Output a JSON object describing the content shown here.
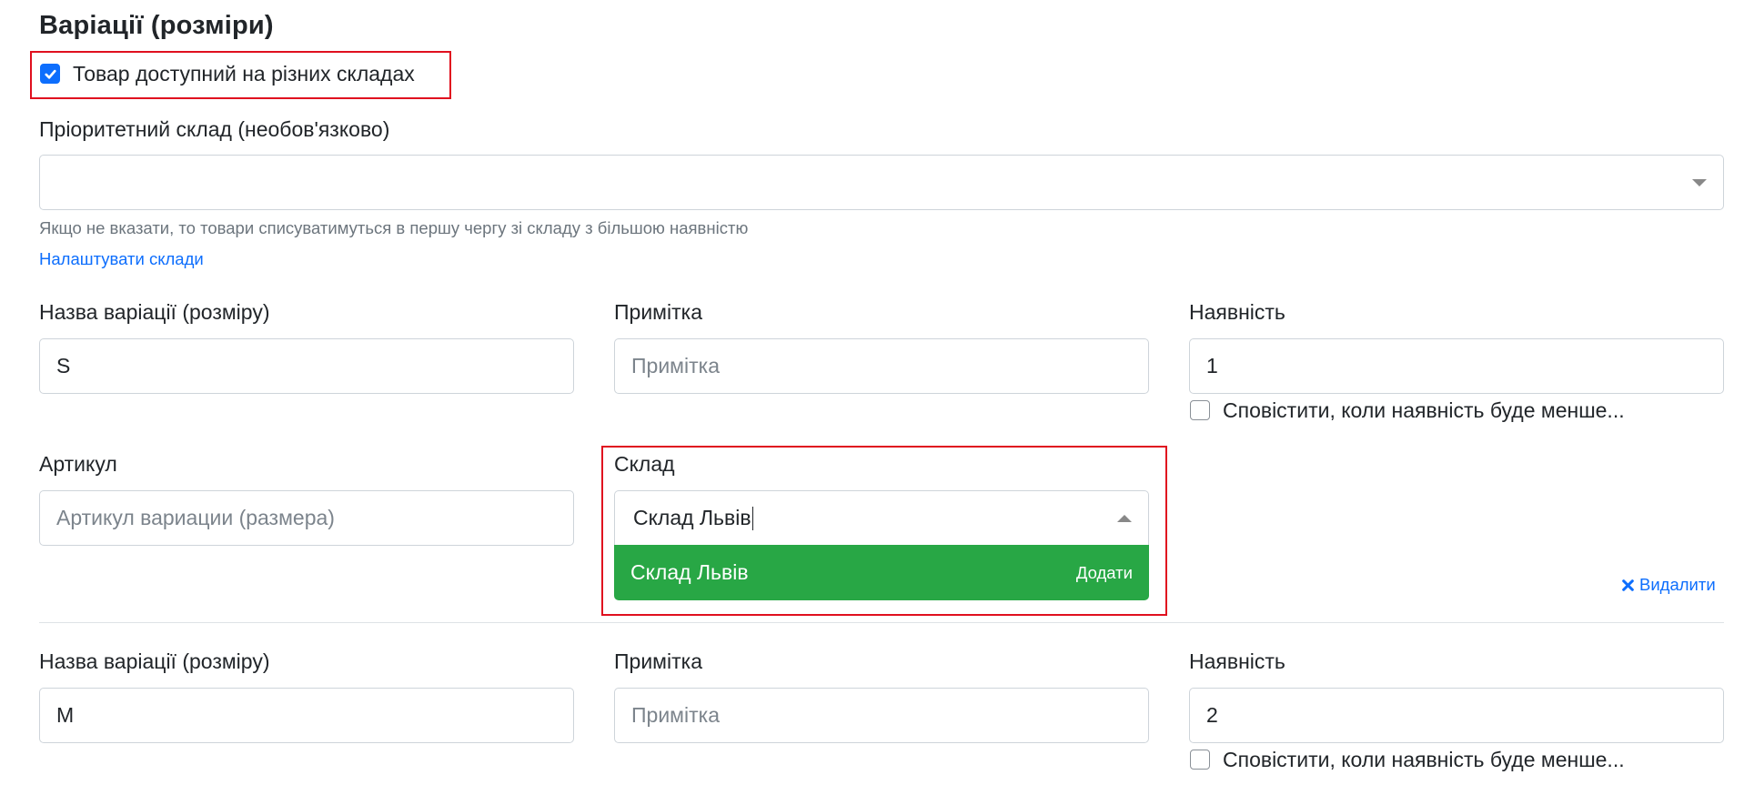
{
  "section_title": "Варіації (розміри)",
  "multi_warehouse": {
    "label": "Товар доступний на різних складах",
    "checked": true
  },
  "priority_warehouse": {
    "label": "Пріоритетний склад (необов'язково)",
    "value": "",
    "help": "Якщо не вказати, то товари списуватимуться в першу чергу зі складу з більшою наявністю",
    "settings_link": "Налаштувати склади"
  },
  "variations": [
    {
      "name_label": "Назва варіації (розміру)",
      "name_value": "S",
      "note_label": "Примітка",
      "note_placeholder": "Примітка",
      "stock_label": "Наявність",
      "stock_value": "1",
      "notify_label": "Сповістити, коли наявність буде менше...",
      "sku_label": "Артикул",
      "sku_placeholder": "Артикул вариации (размера)",
      "warehouse_label": "Склад",
      "warehouse_search": "Склад Львів",
      "dropdown_option": "Склад Львів",
      "dropdown_add": "Додати",
      "delete_label": "Видалити"
    },
    {
      "name_label": "Назва варіації (розміру)",
      "name_value": "M",
      "note_label": "Примітка",
      "note_placeholder": "Примітка",
      "stock_label": "Наявність",
      "stock_value": "2",
      "notify_label": "Сповістити, коли наявність буде менше..."
    }
  ],
  "colors": {
    "accent": "#0d6efd",
    "success": "#28a745",
    "highlight": "#e0101f"
  }
}
